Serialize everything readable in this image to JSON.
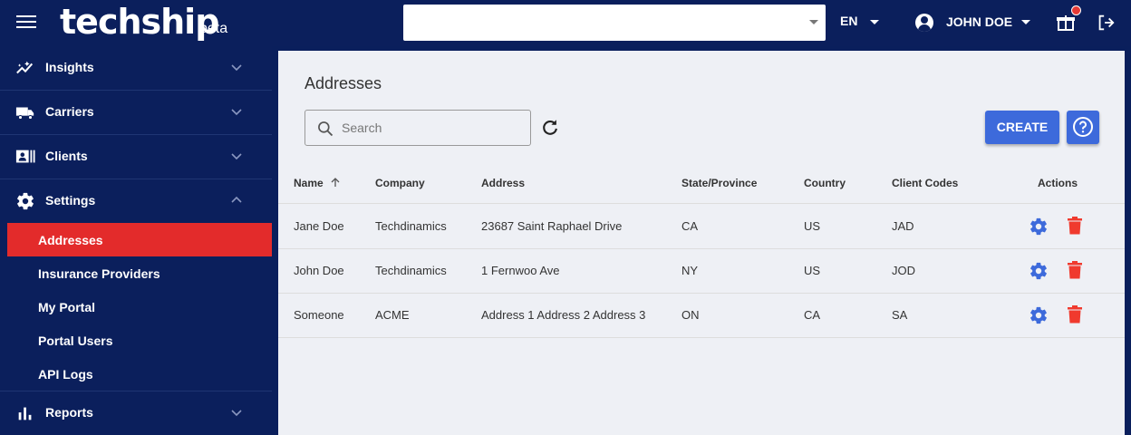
{
  "header": {
    "logo": "techship",
    "logo_suffix": "beta",
    "top_select_value": "",
    "language": "EN",
    "user_name": "JOHN DOE"
  },
  "sidebar": {
    "items": [
      {
        "label": "Insights",
        "icon": "insights-icon"
      },
      {
        "label": "Carriers",
        "icon": "truck-icon"
      },
      {
        "label": "Clients",
        "icon": "contacts-icon"
      },
      {
        "label": "Settings",
        "icon": "gear-icon"
      },
      {
        "label": "Reports",
        "icon": "bar-chart-icon"
      }
    ],
    "settings_sub": [
      {
        "label": "Addresses",
        "active": true
      },
      {
        "label": "Insurance Providers"
      },
      {
        "label": "My Portal"
      },
      {
        "label": "Portal Users"
      },
      {
        "label": "API Logs"
      }
    ]
  },
  "main": {
    "title": "Addresses",
    "search_placeholder": "Search",
    "create_label": "CREATE",
    "table": {
      "headers": [
        "Name",
        "Company",
        "Address",
        "State/Province",
        "Country",
        "Client Codes",
        "Actions"
      ],
      "rows": [
        [
          "Jane Doe",
          "Techdinamics",
          "23687 Saint Raphael Drive",
          "CA",
          "US",
          "JAD"
        ],
        [
          "John Doe",
          "Techdinamics",
          "1 Fernwoo Ave",
          "NY",
          "US",
          "JOD"
        ],
        [
          "Someone",
          "ACME",
          "Address 1 Address 2 Address 3",
          "ON",
          "CA",
          "SA"
        ]
      ]
    }
  },
  "colors": {
    "brand_navy": "#0b1f5c",
    "active_red": "#e32b2b",
    "primary_blue": "#3d6adb",
    "delete_red": "#f03a2e"
  }
}
